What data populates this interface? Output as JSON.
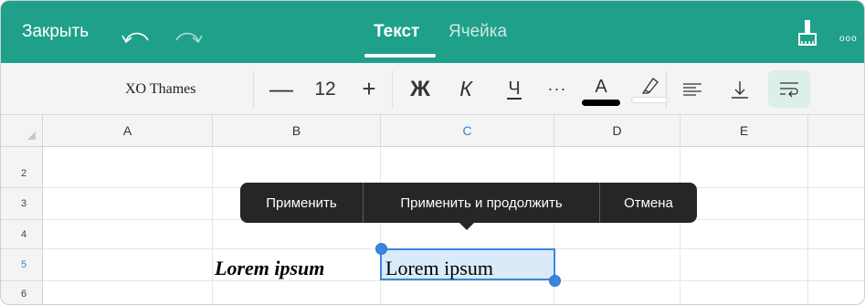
{
  "topbar": {
    "close_label": "Закрыть",
    "undo_icon": "undo-icon",
    "redo_icon": "redo-icon",
    "tabs": [
      {
        "label": "Текст",
        "active": true
      },
      {
        "label": "Ячейка",
        "active": false
      }
    ],
    "brush_icon": "paint-brush-icon",
    "more_icon": "more-icon",
    "more_glyph": "ooo",
    "accent_color": "#1fa08a"
  },
  "toolbar": {
    "font_name": "XO Thames",
    "decrease_glyph": "—",
    "font_size": "12",
    "increase_glyph": "+",
    "bold_glyph": "Ж",
    "italic_glyph": "К",
    "underline_glyph": "Ч",
    "more_glyph": "···",
    "font_color_glyph": "A",
    "font_color": "#000000",
    "highlight_icon": "highlighter-icon",
    "align_icon": "align-left-icon",
    "valign_icon": "align-bottom-icon",
    "wrap_icon": "text-wrap-icon"
  },
  "grid": {
    "columns": [
      "A",
      "B",
      "C",
      "D",
      "E"
    ],
    "selected_column": "C",
    "rows": [
      "2",
      "3",
      "4",
      "5",
      "6"
    ],
    "selected_row": "5",
    "cell_b5": "Lorem ipsum",
    "cell_c5_editing": "Lorem ipsum"
  },
  "popup": {
    "apply": "Применить",
    "apply_continue": "Применить и продолжить",
    "cancel": "Отмена"
  }
}
